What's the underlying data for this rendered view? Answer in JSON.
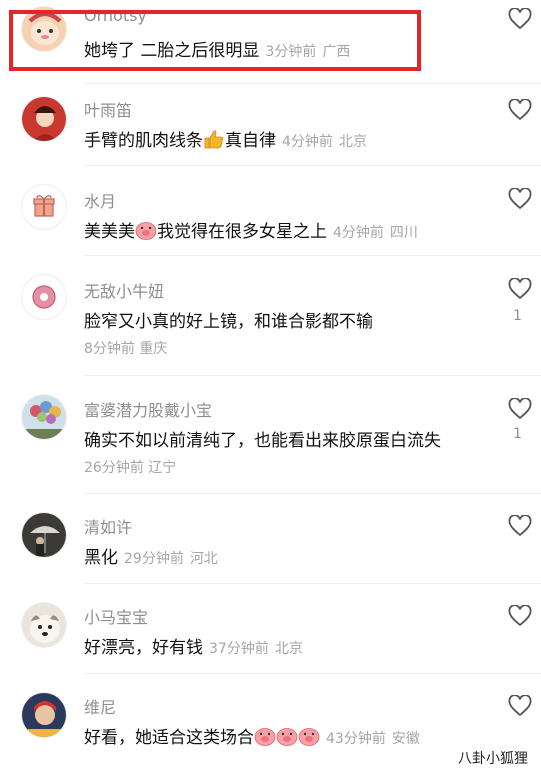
{
  "comments": [
    {
      "user": "Ornotsy",
      "text": "她垮了 二胎之后很明显",
      "time": "3分钟前",
      "region": "广西",
      "likes": ""
    },
    {
      "user": "叶雨笛",
      "text_a": "手臂的肌肉线条",
      "text_b": "真自律",
      "time": "4分钟前",
      "region": "北京",
      "likes": ""
    },
    {
      "user": "水月",
      "text_a": "美美美",
      "text_b": "我觉得在很多女星之上",
      "time": "4分钟前",
      "region": "四川",
      "likes": ""
    },
    {
      "user": "无敌小牛妞",
      "text": "脸窄又小真的好上镜，和谁合影都不输",
      "time": "8分钟前",
      "region": "重庆",
      "likes": "1"
    },
    {
      "user": "富婆潜力股戴小宝",
      "text": "确实不如以前清纯了，也能看出来胶原蛋白流失",
      "time": "26分钟前",
      "region": "辽宁",
      "likes": "1"
    },
    {
      "user": "清如许",
      "text": "黑化",
      "time": "29分钟前",
      "region": "河北",
      "likes": ""
    },
    {
      "user": "小马宝宝",
      "text": "好漂亮，好有钱",
      "time": "37分钟前",
      "region": "北京",
      "likes": ""
    },
    {
      "user": "维尼",
      "text": "好看，她适合这类场合",
      "time": "43分钟前",
      "region": "安徽",
      "likes": ""
    }
  ],
  "watermark": "八卦小狐狸",
  "colors": {
    "highlight": "#e8242b",
    "username": "#8f8f8f",
    "meta": "#a6a6a6"
  }
}
